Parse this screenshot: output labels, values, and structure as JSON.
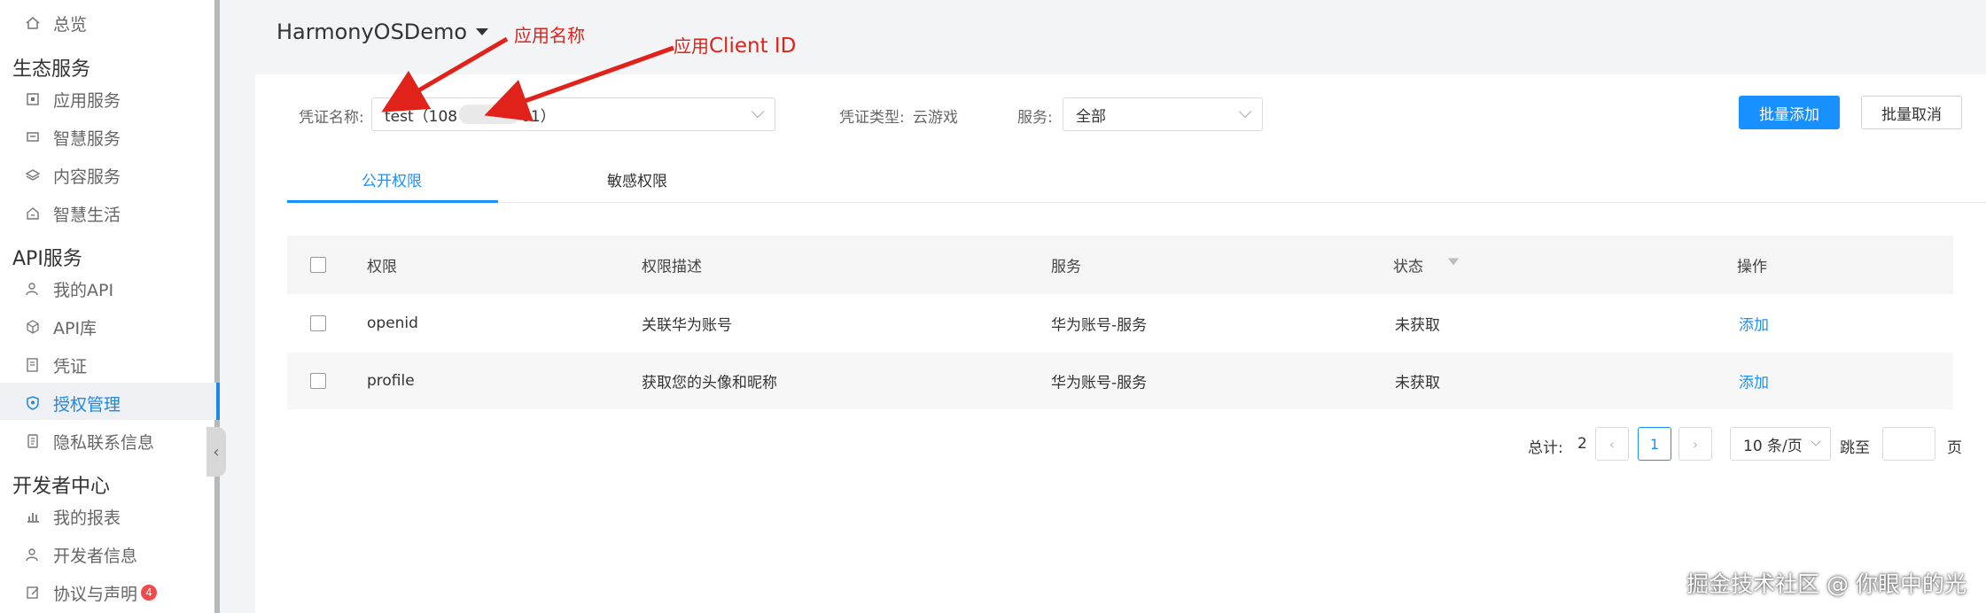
{
  "sidebar": {
    "items": [
      {
        "label": "总览",
        "icon": "home-icon"
      },
      {
        "label": "应用服务",
        "icon": "app-service-icon"
      },
      {
        "label": "智慧服务",
        "icon": "smart-service-icon"
      },
      {
        "label": "内容服务",
        "icon": "layers-icon"
      },
      {
        "label": "智慧生活",
        "icon": "smart-life-icon"
      },
      {
        "label": "我的API",
        "icon": "user-icon"
      },
      {
        "label": "API库",
        "icon": "cube-icon"
      },
      {
        "label": "凭证",
        "icon": "credential-icon"
      },
      {
        "label": "授权管理",
        "icon": "shield-icon",
        "active": true
      },
      {
        "label": "隐私联系信息",
        "icon": "document-icon"
      },
      {
        "label": "我的报表",
        "icon": "bar-chart-icon"
      },
      {
        "label": "开发者信息",
        "icon": "user-icon"
      },
      {
        "label": "协议与声明",
        "icon": "edit-icon",
        "badge": "4"
      }
    ],
    "groups": [
      "生态服务",
      "API服务",
      "开发者中心"
    ]
  },
  "header": {
    "app_name": "HarmonyOSDemo"
  },
  "annotations": {
    "app_name": "应用名称",
    "client_id_prefix": "应用",
    "client_id": "Client ID"
  },
  "filters": {
    "credential_label": "凭证名称:",
    "credential_value_prefix": "test（108",
    "credential_value_suffix": "01）",
    "credential_type_label": "凭证类型:",
    "credential_type_value": "云游戏",
    "service_label": "服务:",
    "service_value": "全部"
  },
  "actions": {
    "batch_add": "批量添加",
    "batch_cancel": "批量取消"
  },
  "tabs": [
    {
      "label": "公开权限",
      "active": true
    },
    {
      "label": "敏感权限",
      "active": false
    }
  ],
  "table": {
    "columns": [
      "权限",
      "权限描述",
      "服务",
      "状态",
      "操作"
    ],
    "rows": [
      {
        "permission": "openid",
        "description": "关联华为账号",
        "service": "华为账号-服务",
        "status": "未获取",
        "action": "添加"
      },
      {
        "permission": "profile",
        "description": "获取您的头像和昵称",
        "service": "华为账号-服务",
        "status": "未获取",
        "action": "添加"
      }
    ]
  },
  "pagination": {
    "total_label": "总计:",
    "total": "2",
    "current_page": "1",
    "page_size": "10 条/页",
    "jump_label": "跳至",
    "page_suffix": "页"
  },
  "watermark": "掘金技术社区 @ 你眼中的光",
  "colors": {
    "accent": "#1890ff",
    "annotation": "#e0221a",
    "active_nav": "#1e88e5"
  }
}
